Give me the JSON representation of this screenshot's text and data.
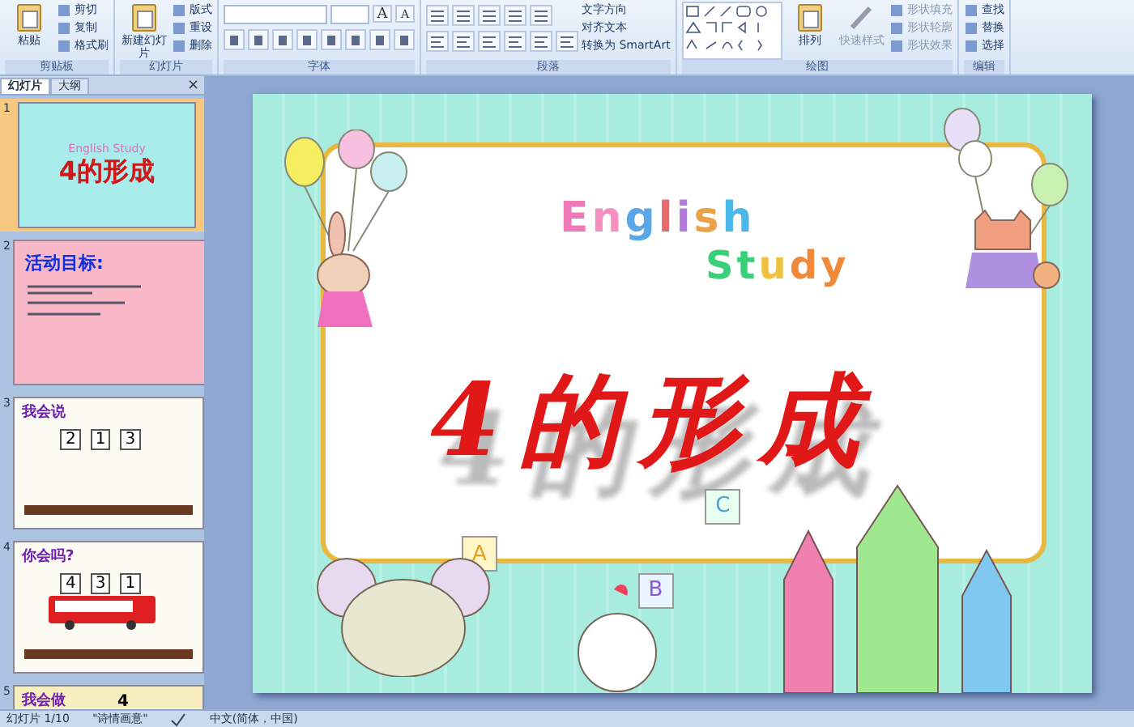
{
  "ribbon": {
    "groups": [
      {
        "label": "剪贴板",
        "big": {
          "label": "粘贴"
        },
        "small": [
          {
            "label": "剪切"
          },
          {
            "label": "复制"
          },
          {
            "label": "格式刷"
          }
        ]
      },
      {
        "label": "幻灯片",
        "big": {
          "label": "新建幻灯片"
        },
        "small": [
          {
            "label": "版式"
          },
          {
            "label": "重设"
          },
          {
            "label": "删除"
          }
        ]
      },
      {
        "label": "字体",
        "kind": "font",
        "grow": "A",
        "shrink": "A"
      },
      {
        "label": "段落",
        "kind": "para",
        "small": [
          {
            "label": "文字方向"
          },
          {
            "label": "对齐文本"
          },
          {
            "label": "转换为 SmartArt"
          }
        ]
      },
      {
        "label": "绘图",
        "kind": "draw",
        "big": {
          "label": "排列"
        },
        "mid": {
          "label": "快速样式"
        },
        "small": [
          {
            "label": "形状填充"
          },
          {
            "label": "形状轮廓"
          },
          {
            "label": "形状效果"
          }
        ]
      },
      {
        "label": "编辑",
        "small": [
          {
            "label": "查找"
          },
          {
            "label": "替换"
          },
          {
            "label": "选择"
          }
        ]
      }
    ]
  },
  "panel": {
    "tabs": [
      {
        "label": "幻灯片",
        "selected": true
      },
      {
        "label": "大纲",
        "selected": false
      }
    ],
    "close": "×"
  },
  "slides": [
    {
      "number": "1",
      "kind": "title",
      "selected": true,
      "heading": "4的形成",
      "sub": "English Study"
    },
    {
      "number": "2",
      "kind": "goals",
      "selected": false,
      "heading": "活动目标:"
    },
    {
      "number": "3",
      "kind": "count",
      "selected": false,
      "heading": "我会说",
      "digits": [
        "2",
        "1",
        "3"
      ]
    },
    {
      "number": "4",
      "kind": "bus",
      "selected": false,
      "heading": "你会吗?",
      "digits": [
        "4",
        "3",
        "1"
      ]
    },
    {
      "number": "5",
      "kind": "partial",
      "selected": false,
      "heading": "我会做",
      "digits": [
        "4"
      ]
    }
  ],
  "slide": {
    "english": [
      {
        "char": "E",
        "color": "#f07ab8"
      },
      {
        "char": "n",
        "color": "#f58fc0"
      },
      {
        "char": "g",
        "color": "#5aa7e8"
      },
      {
        "char": "l",
        "color": "#e86a6a"
      },
      {
        "char": "i",
        "color": "#b07ae0"
      },
      {
        "char": "s",
        "color": "#e8a24a"
      },
      {
        "char": "h",
        "color": "#4ab8e8"
      }
    ],
    "study": [
      {
        "char": "S",
        "color": "#3ad07a"
      },
      {
        "char": "t",
        "color": "#3ad07a"
      },
      {
        "char": "u",
        "color": "#f0c040"
      },
      {
        "char": "d",
        "color": "#f08a3a"
      },
      {
        "char": "y",
        "color": "#f08a3a"
      }
    ],
    "title": "4的形成",
    "blocks": [
      "A",
      "B",
      "C"
    ]
  },
  "status": {
    "slide": "幻灯片 1/10",
    "theme": "\"诗情画意\"",
    "language": "中文(简体，中国)"
  }
}
